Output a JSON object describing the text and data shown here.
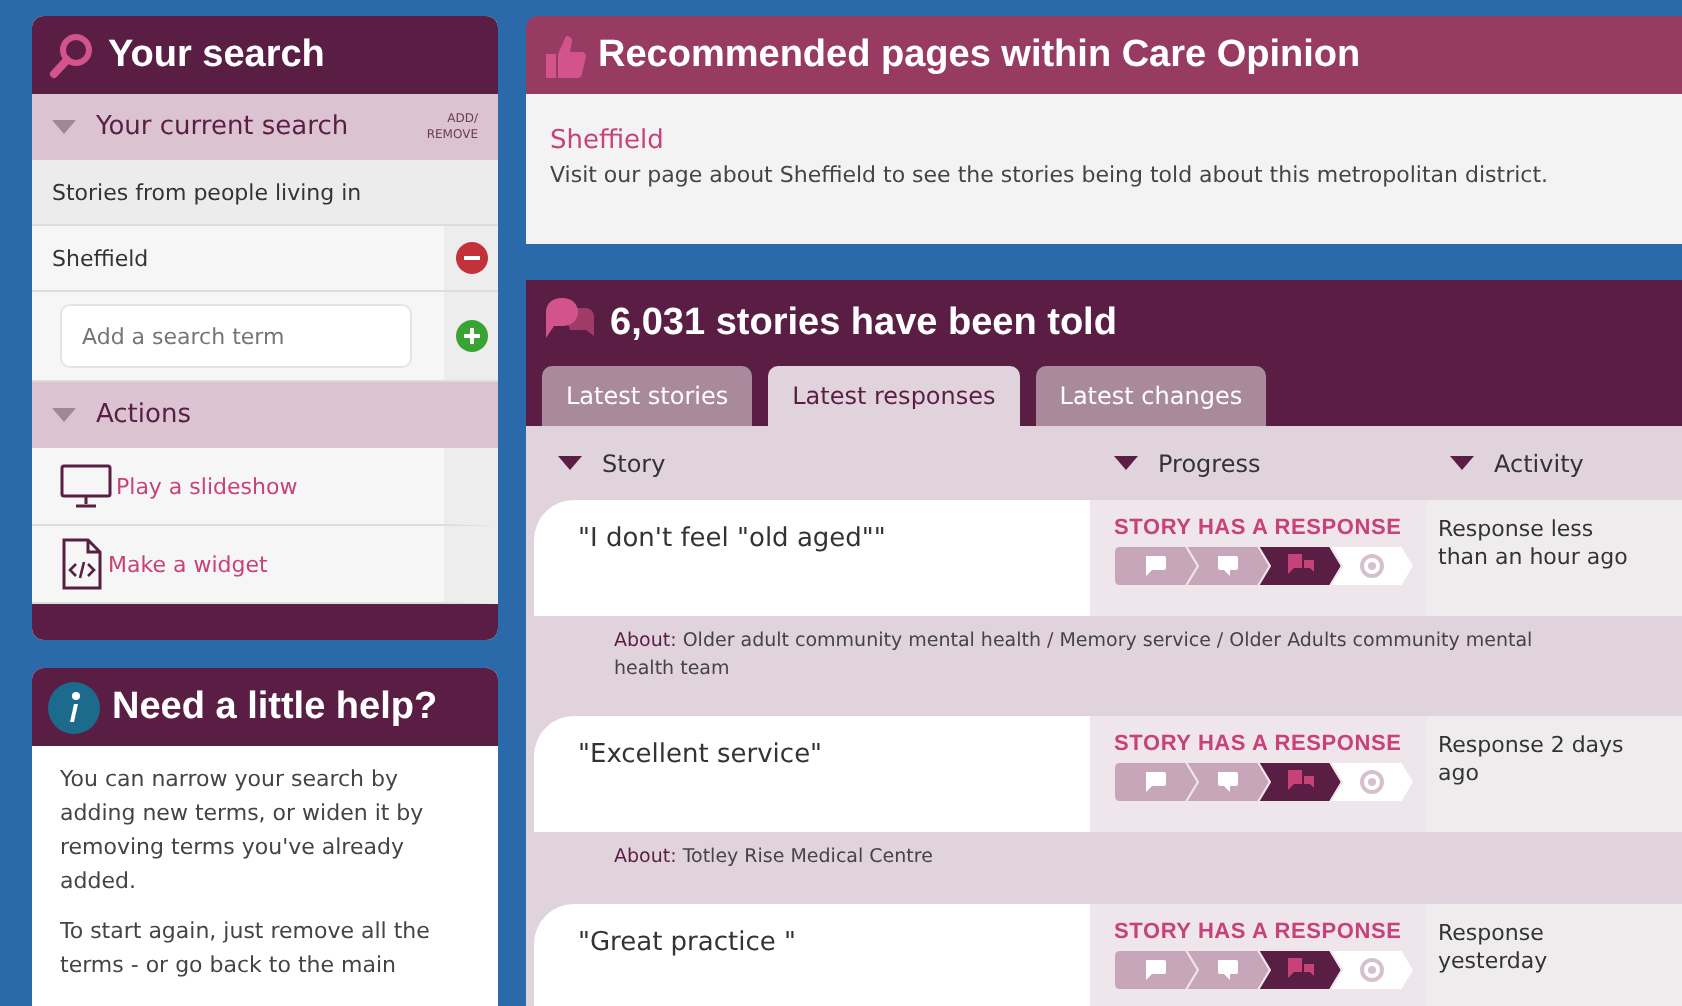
{
  "search_panel": {
    "title": "Your search",
    "current_search": {
      "label": "Your current search",
      "expanded": true,
      "add_remove": [
        "ADD/",
        "REMOVE"
      ],
      "intro": "Stories from people living in",
      "terms": [
        {
          "text": "Sheffield"
        }
      ],
      "input": {
        "placeholder": "Add a search term"
      }
    },
    "actions": {
      "label": "Actions",
      "expanded": true,
      "items": [
        {
          "kind": "slideshow",
          "label": "Play a slideshow"
        },
        {
          "kind": "widget",
          "label": "Make a widget"
        }
      ]
    }
  },
  "help_panel": {
    "title": "Need a little help?",
    "paragraphs": [
      "You can narrow your search by adding new terms, or widen it by removing terms you've already added.",
      "To start again, just remove all the terms - or go back to the main"
    ]
  },
  "recommended": {
    "title": "Recommended pages within Care Opinion",
    "link": "Sheffield",
    "description": "Visit our page about Sheffield to see the stories being told about this metropolitan district."
  },
  "stories": {
    "title": "6,031 stories have been told",
    "tabs": [
      {
        "label": "Latest stories",
        "selected": false
      },
      {
        "label": "Latest responses",
        "selected": true
      },
      {
        "label": "Latest changes",
        "selected": false
      }
    ],
    "columns": [
      "Story",
      "Progress",
      "Activity"
    ],
    "rows": [
      {
        "title": "\"I don't feel \"old aged\"\"",
        "status": "STORY HAS A RESPONSE",
        "steps": [
          {
            "done": true,
            "current": false
          },
          {
            "done": true,
            "current": false
          },
          {
            "done": false,
            "current": true
          },
          {
            "done": false,
            "current": false
          }
        ],
        "activity": "Response less than an hour ago",
        "about_label": "About:",
        "about": "Older adult community mental health / Memory service / Older Adults community mental health team"
      },
      {
        "title": "\"Excellent service\"",
        "status": "STORY HAS A RESPONSE",
        "steps": [
          {
            "done": true,
            "current": false
          },
          {
            "done": true,
            "current": false
          },
          {
            "done": false,
            "current": true
          },
          {
            "done": false,
            "current": false
          }
        ],
        "activity": "Response 2 days ago",
        "about_label": "About:",
        "about": "Totley Rise Medical Centre"
      },
      {
        "title": "\"Great practice \"",
        "status": "STORY HAS A RESPONSE",
        "steps": [
          {
            "done": true,
            "current": false
          },
          {
            "done": true,
            "current": false
          },
          {
            "done": false,
            "current": true
          },
          {
            "done": false,
            "current": false
          }
        ],
        "activity": "Response yesterday"
      }
    ]
  }
}
